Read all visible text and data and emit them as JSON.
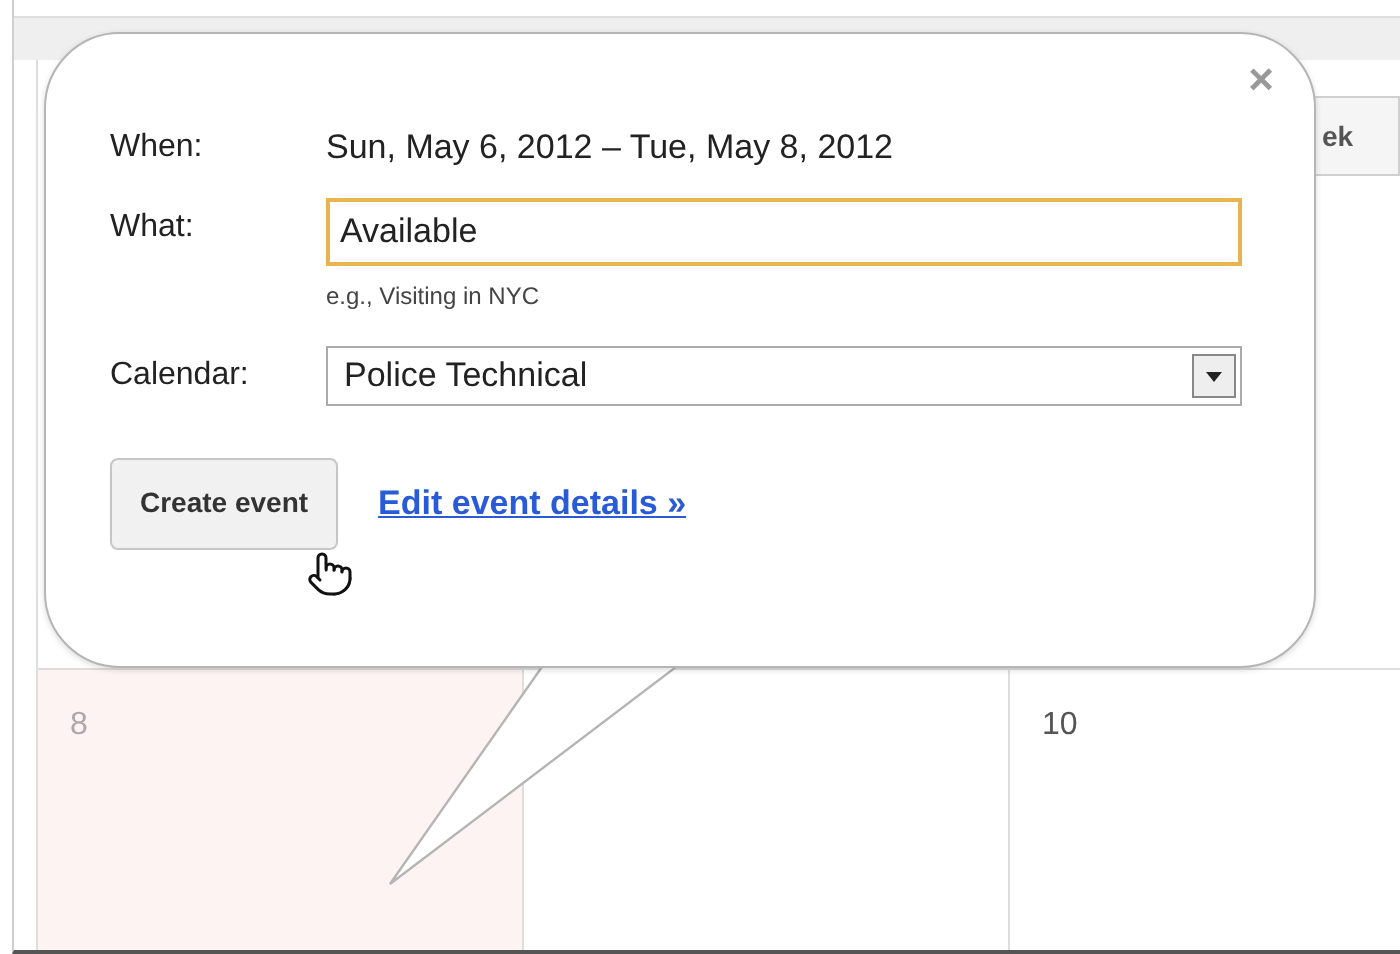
{
  "calendar_view": {
    "view_button": "ek",
    "days": [
      {
        "label": "8",
        "selected": true
      },
      {
        "selected": false
      },
      {
        "label": "10",
        "selected": false
      }
    ]
  },
  "popup": {
    "close": "×",
    "when": {
      "label": "When:",
      "value": "Sun, May 6, 2012 – Tue, May 8, 2012"
    },
    "what": {
      "label": "What:",
      "value": "Available",
      "hint": "e.g., Visiting in NYC"
    },
    "calendar": {
      "label": "Calendar:",
      "value": "Police Technical"
    },
    "create_button": "Create event",
    "edit_link": "Edit event details »"
  }
}
